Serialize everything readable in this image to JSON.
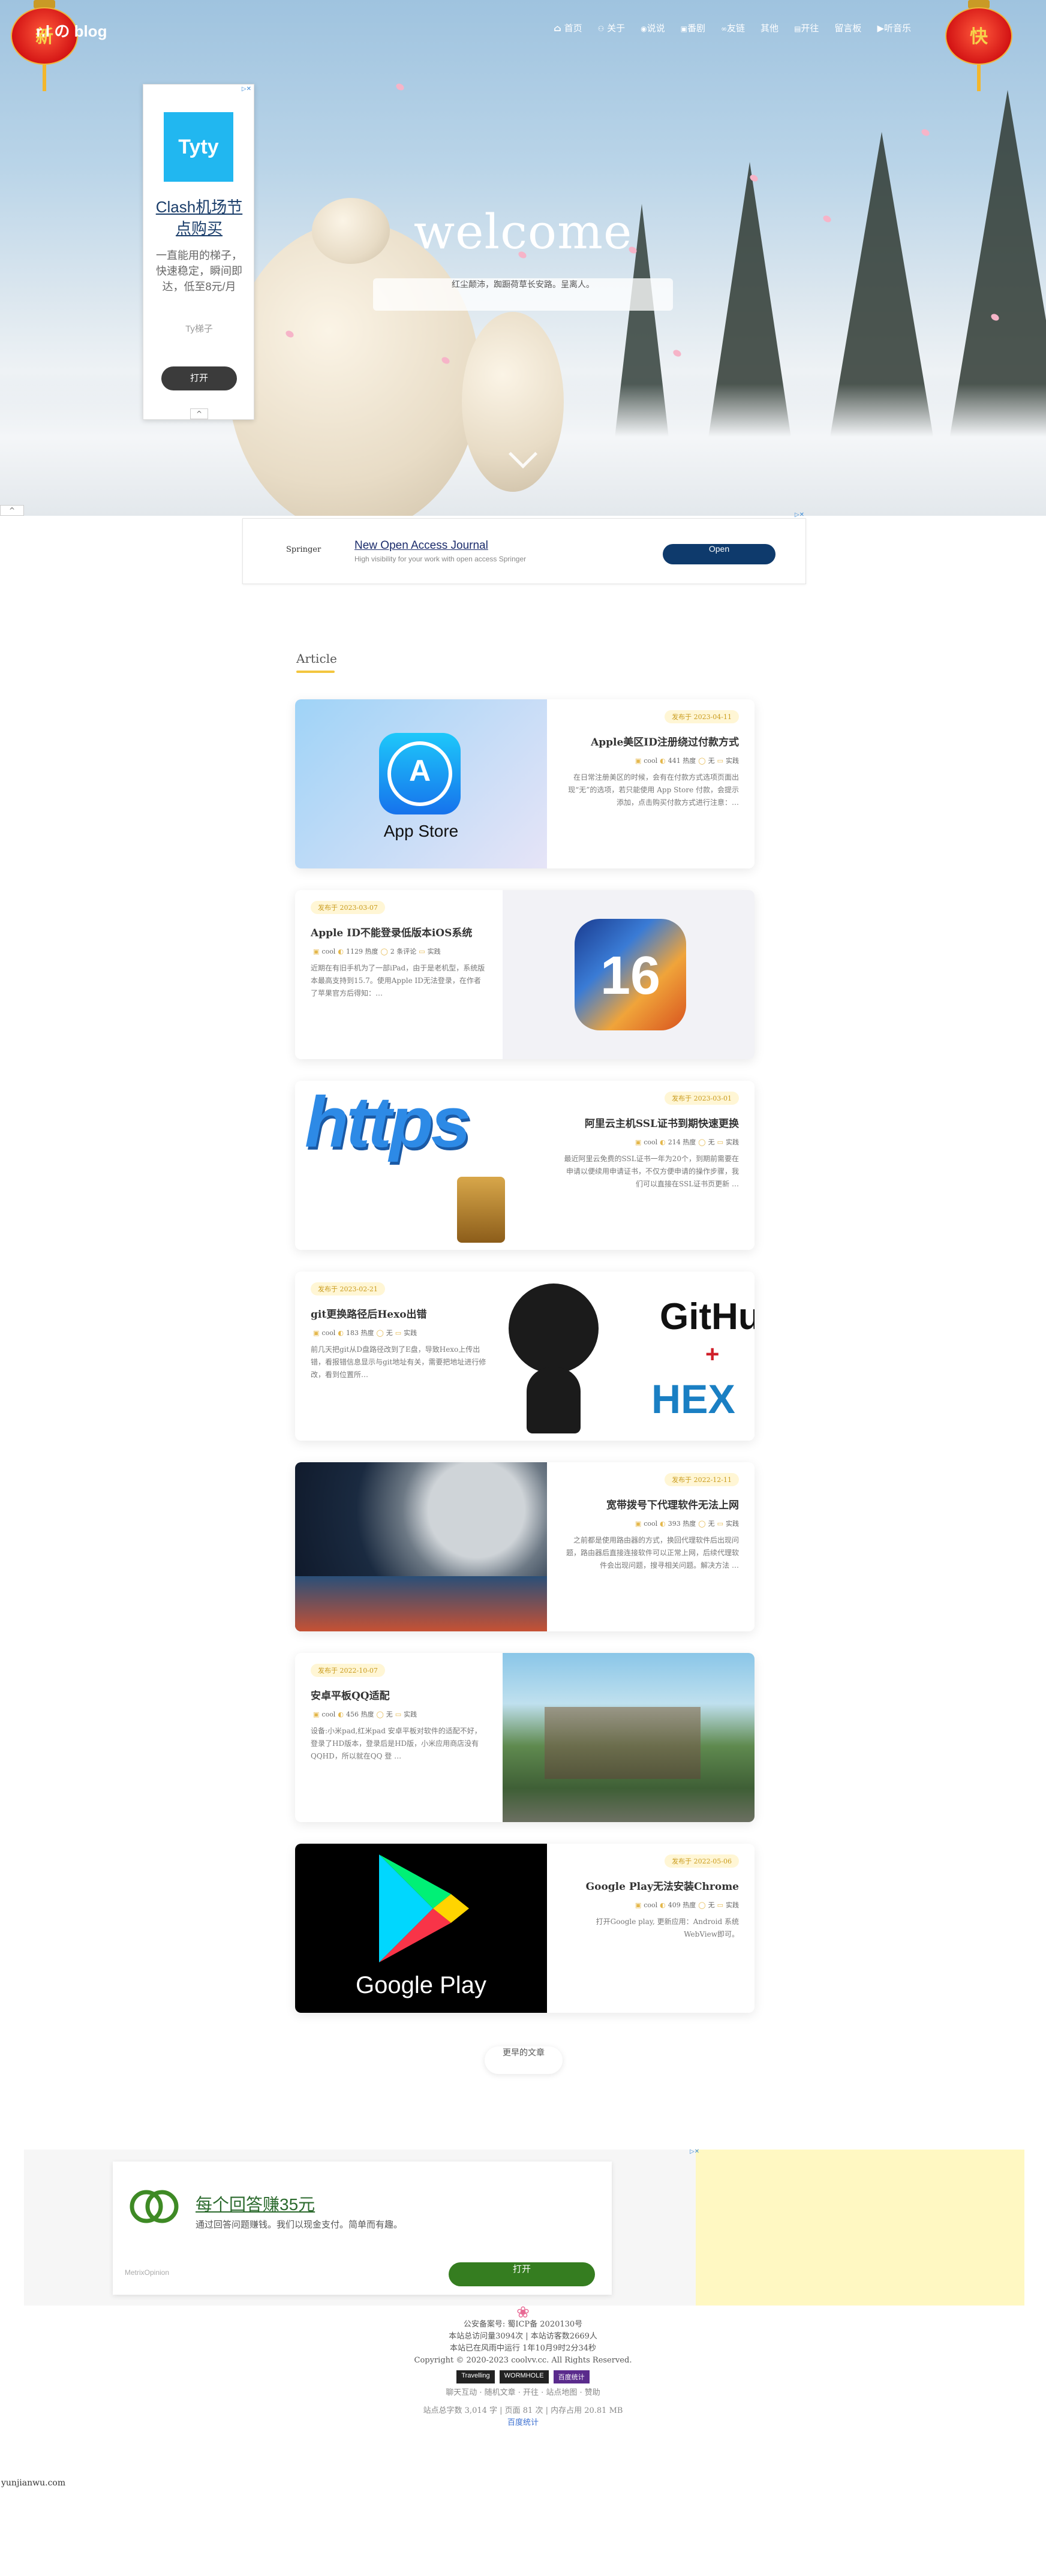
{
  "nav": {
    "brand": "r.l の blog",
    "items": [
      {
        "label": "首页",
        "icon": "home-icon",
        "glyph": "⌂"
      },
      {
        "label": "关于",
        "icon": "user-icon",
        "glyph": "👤"
      },
      {
        "label": "说说",
        "icon": "chat-icon",
        "glyph": "💬"
      },
      {
        "label": "番剧",
        "icon": "tv-icon",
        "glyph": "📺"
      },
      {
        "label": "友链",
        "icon": "link-icon",
        "glyph": "🔗"
      },
      {
        "label": "其他",
        "icon": "more-icon",
        "glyph": ""
      },
      {
        "label": "开往",
        "icon": "train-icon",
        "glyph": "🚆"
      },
      {
        "label": "留言板",
        "icon": "message-icon",
        "glyph": ""
      },
      {
        "label": "听音乐",
        "icon": "music-icon",
        "glyph": "▶"
      }
    ],
    "lanterns": [
      "新",
      "年",
      "节",
      "快"
    ]
  },
  "hero": {
    "title": "welcome",
    "subtitle": "红尘颠沛，踟蹰荷草长安路。呈离人。"
  },
  "ad_side": {
    "logo": "Tyty",
    "title": "Clash机场节点购买",
    "desc": "一直能用的梯子，快速稳定，瞬间即达，低至8元/月",
    "brand": "Ty梯子",
    "button": "打开",
    "collapse": "^",
    "close": "▷✕"
  },
  "ad_top": {
    "brand": "Springer",
    "title": "New Open Access Journal",
    "desc": "High visibility for your work with open access Springer",
    "button": "Open",
    "close": "▷✕"
  },
  "section": {
    "title": "Article"
  },
  "posts": [
    {
      "date": "发布于 2023-04-11",
      "title": "Apple美区ID注册绕过付款方式",
      "author": "cool",
      "views": "441 热度",
      "comments": "无",
      "category": "实践",
      "excerpt": "在日常注册美区的时候，会有在付款方式选项页面出现“无”的选项，若只能使用 App Store 付款，会提示添加，点击购买付款方式进行注意：…",
      "image_label": "App Store"
    },
    {
      "date": "发布于 2023-03-07",
      "title": "Apple ID不能登录低版本iOS系统",
      "author": "cool",
      "views": "1129 热度",
      "comments": "2 条评论",
      "category": "实践",
      "excerpt": "近期在有旧手机为了一部iPad，由于是老机型，系统版本最高支持到15.7。使用Apple ID无法登录，在作者了苹果官方后得知：…",
      "image_label": "16"
    },
    {
      "date": "发布于 2023-03-01",
      "title": "阿里云主机SSL证书到期快速更换",
      "author": "cool",
      "views": "214 热度",
      "comments": "无",
      "category": "实践",
      "excerpt": "最近阿里云免费的SSL证书一年为20个，到期前需要在申请以便续用申请证书，不仅方便申请的操作步骤，我们可以直接在SSL证书页更新 …",
      "image_label": "https"
    },
    {
      "date": "发布于 2023-02-21",
      "title": "git更换路径后Hexo出错",
      "author": "cool",
      "views": "183 热度",
      "comments": "无",
      "category": "实践",
      "excerpt": "前几天把git从D盘路径改到了E盘，导致Hexo上传出错，看报错信息显示与git地址有关，需要把地址进行修改，看到位置所…",
      "image_label": "GitHub + HEXO"
    },
    {
      "date": "发布于 2022-12-11",
      "title": "宽带拨号下代理软件无法上网",
      "author": "cool",
      "views": "393 热度",
      "comments": "无",
      "category": "实践",
      "excerpt": "之前都是使用路由器的方式，换回代理软件后出现问题，路由器后直接连接软件可以正常上网，后续代理软件会出现问题，搜寻相关问题。解决方法 …",
      "image_label": "space"
    },
    {
      "date": "发布于 2022-10-07",
      "title": "安卓平板QQ适配",
      "author": "cool",
      "views": "456 热度",
      "comments": "无",
      "category": "实践",
      "excerpt": "设备:小米pad,红米pad 安卓平板对软件的适配不好，登录了HD版本，登录后是HD版，小米应用商店没有QQHD，所以就在QQ 登 …",
      "image_label": "village"
    },
    {
      "date": "发布于 2022-05-06",
      "title": "Google Play无法安装Chrome",
      "author": "cool",
      "views": "409 热度",
      "comments": "无",
      "category": "实践",
      "excerpt": "打开Google play, 更新应用：Android 系统 WebView即可。",
      "image_label": "Google Play"
    }
  ],
  "older": "更早的文章",
  "ad_bottom": {
    "title": "每个回答赚35元",
    "desc": "通过回答问题赚钱。我们以现金支付。简单而有趣。",
    "brand": "MetrixOpinion",
    "button": "打开",
    "close": "▷✕"
  },
  "footer": {
    "flower": "❀",
    "lines": [
      "公安备案号: 蜀ICP备 2020130号",
      "本站总访问量3094次 | 本站访客数2669人",
      "本站已在风雨中运行 1年10月9时2分34秒",
      "Copyright © 2020-2023 coolvv.cc. All Rights Reserved."
    ],
    "badges": [
      "Travelling",
      "WORMHOLE",
      "百度统计"
    ],
    "links": "聊天互动 · 随机文章 · 开往 · 站点地图 · 赞助",
    "stats": "站点总字数 3,014 字 | 页面 81 次 | 内存占用 20.81 MB",
    "stats2": "百度统计"
  },
  "bottom_left": "yunjianwu.com"
}
